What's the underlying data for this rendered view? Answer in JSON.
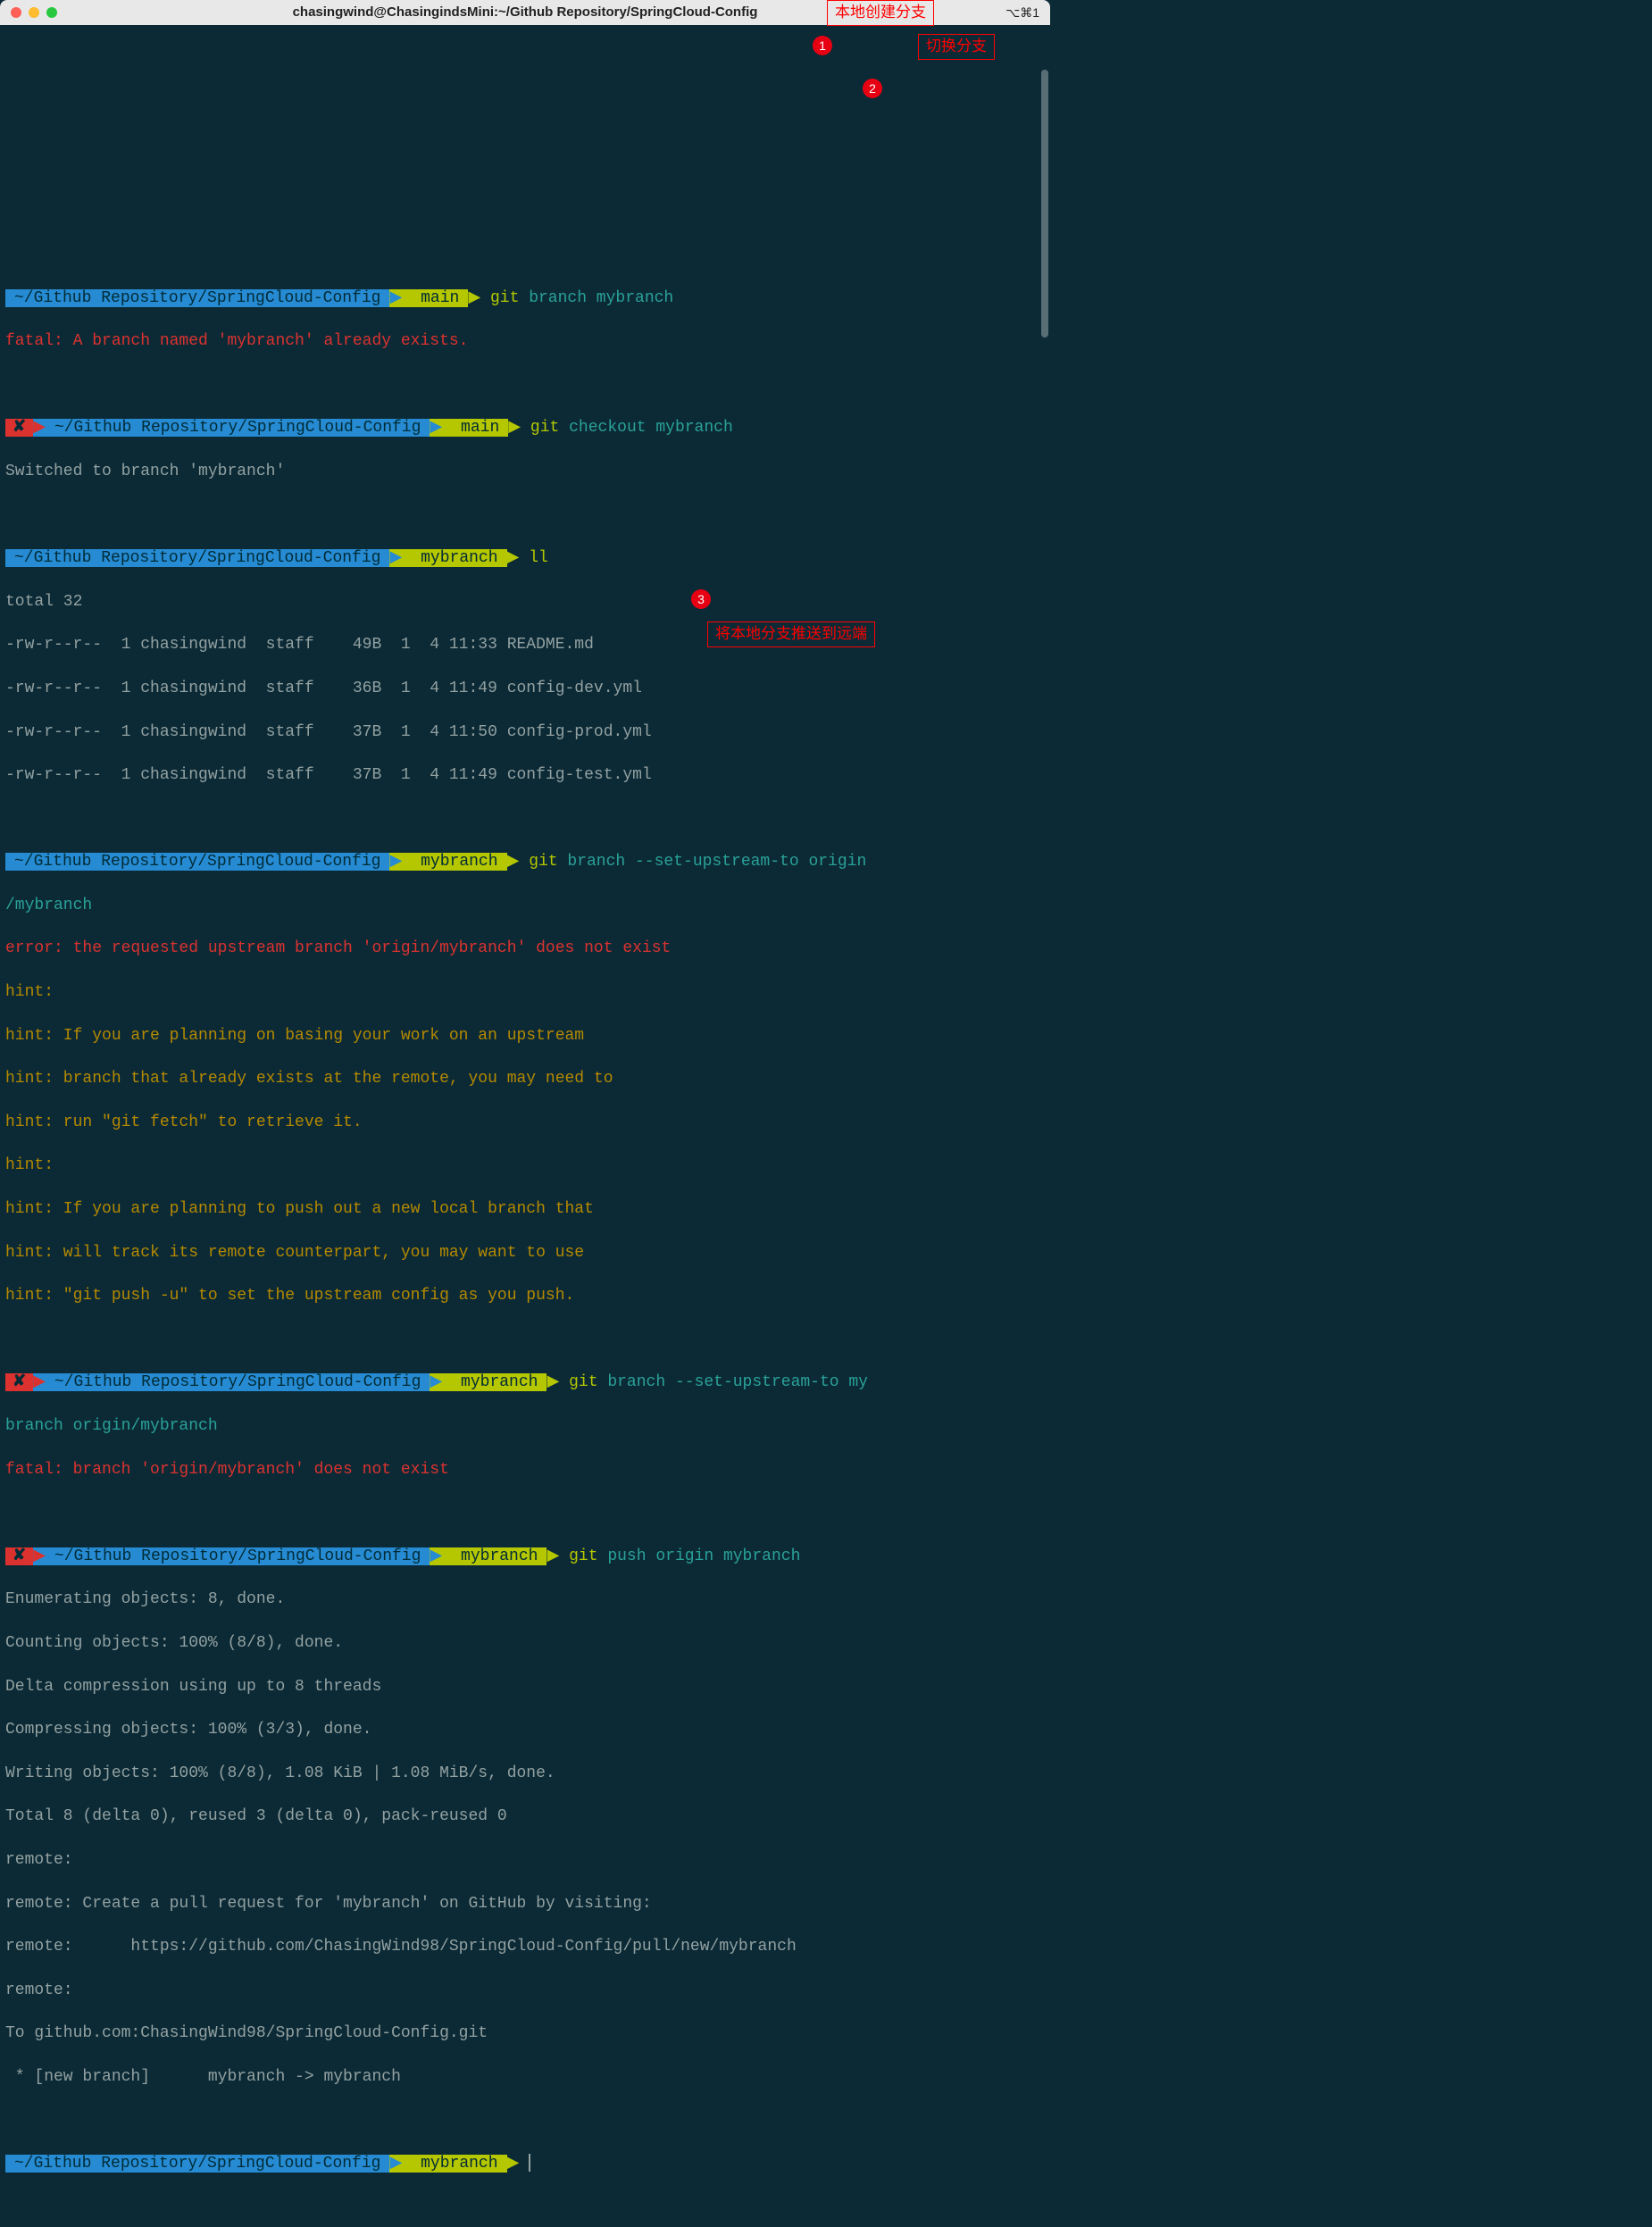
{
  "titlebar": {
    "title": "chasingwind@ChasingindsMini:~/Github Repository/SpringCloud-Config",
    "right": "⌥⌘1"
  },
  "annotations": {
    "a1": "本地创建分支",
    "a2": "切换分支",
    "a3": "将本地分支推送到远端",
    "b1": "1",
    "b2": "2",
    "b3": "3"
  },
  "path": "~/Github Repository/SpringCloud-Config",
  "branch_main": " main",
  "branch_mybranch": " mybranch",
  "cmd1": {
    "git": "git",
    "rest": " branch mybranch"
  },
  "out1": "fatal: A branch named 'mybranch' already exists.",
  "cmd2": {
    "git": "git",
    "rest": " checkout mybranch"
  },
  "out2": "Switched to branch 'mybranch'",
  "cmd3": "ll",
  "ll": [
    "total 32",
    "-rw-r--r--  1 chasingwind  staff    49B  1  4 11:33 README.md",
    "-rw-r--r--  1 chasingwind  staff    36B  1  4 11:49 config-dev.yml",
    "-rw-r--r--  1 chasingwind  staff    37B  1  4 11:50 config-prod.yml",
    "-rw-r--r--  1 chasingwind  staff    37B  1  4 11:49 config-test.yml"
  ],
  "cmd4": {
    "git": "git",
    "rest": " branch --set-upstream-to origin"
  },
  "cmd4b": "/mybranch",
  "out4": [
    "error: the requested upstream branch 'origin/mybranch' does not exist",
    "hint:",
    "hint: If you are planning on basing your work on an upstream",
    "hint: branch that already exists at the remote, you may need to",
    "hint: run \"git fetch\" to retrieve it.",
    "hint:",
    "hint: If you are planning to push out a new local branch that",
    "hint: will track its remote counterpart, you may want to use",
    "hint: \"git push -u\" to set the upstream config as you push."
  ],
  "cmd5": {
    "git": "git",
    "rest": " branch --set-upstream-to my"
  },
  "cmd5b": "branch origin/mybranch",
  "out5": "fatal: branch 'origin/mybranch' does not exist",
  "cmd6": {
    "git": "git",
    "rest": " push origin mybranch"
  },
  "out6": [
    "Enumerating objects: 8, done.",
    "Counting objects: 100% (8/8), done.",
    "Delta compression using up to 8 threads",
    "Compressing objects: 100% (3/3), done.",
    "Writing objects: 100% (8/8), 1.08 KiB | 1.08 MiB/s, done.",
    "Total 8 (delta 0), reused 3 (delta 0), pack-reused 0",
    "remote:",
    "remote: Create a pull request for 'mybranch' on GitHub by visiting:",
    "remote:      https://github.com/ChasingWind98/SpringCloud-Config/pull/new/mybranch",
    "remote:",
    "To github.com:ChasingWind98/SpringCloud-Config.git",
    " * [new branch]      mybranch -> mybranch"
  ],
  "x_mark": "✘"
}
